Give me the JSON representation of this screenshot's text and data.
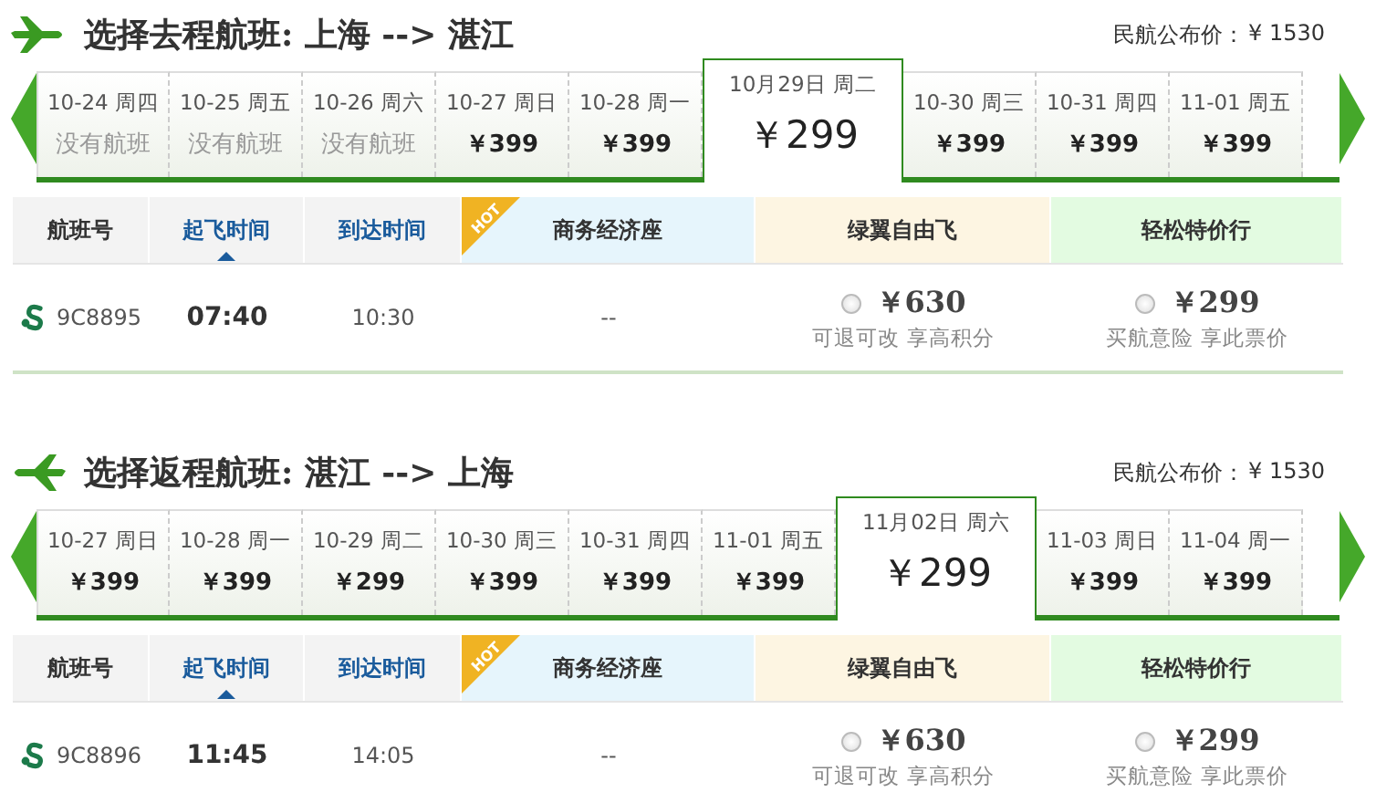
{
  "sections": [
    {
      "kind": "outbound",
      "title": "选择去程航班: 上海 --> 湛江",
      "published_price_label": "民航公布价：",
      "published_price": "¥ 1530",
      "dates": [
        {
          "date": "10-24 周四",
          "price": "没有航班",
          "available": false,
          "selected": false
        },
        {
          "date": "10-25 周五",
          "price": "没有航班",
          "available": false,
          "selected": false
        },
        {
          "date": "10-26 周六",
          "price": "没有航班",
          "available": false,
          "selected": false
        },
        {
          "date": "10-27 周日",
          "price": "￥399",
          "available": true,
          "selected": false
        },
        {
          "date": "10-28 周一",
          "price": "￥399",
          "available": true,
          "selected": false
        },
        {
          "date": "10月29日 周二",
          "price": "￥299",
          "available": true,
          "selected": true
        },
        {
          "date": "10-30 周三",
          "price": "￥399",
          "available": true,
          "selected": false
        },
        {
          "date": "10-31 周四",
          "price": "￥399",
          "available": true,
          "selected": false
        },
        {
          "date": "11-01 周五",
          "price": "￥399",
          "available": true,
          "selected": false
        }
      ],
      "columns": [
        {
          "label": "航班号",
          "kind": "plain",
          "sorted": false
        },
        {
          "label": "起飞时间",
          "kind": "sortable",
          "sorted": true
        },
        {
          "label": "到达时间",
          "kind": "sortable",
          "sorted": false
        },
        {
          "label": "商务经济座",
          "kind": "fare",
          "color": "#e6f5fc",
          "badge": "HOT"
        },
        {
          "label": "绿翼自由飞",
          "kind": "fare",
          "color": "#fdf5e2"
        },
        {
          "label": "轻松特价行",
          "kind": "fare",
          "color": "#e3fbe1"
        }
      ],
      "flights": [
        {
          "flight_no": "9C8895",
          "depart": "07:40",
          "arrive": "10:30",
          "business": "--",
          "fares": [
            {
              "price": "￥630",
              "note": "可退可改 享高积分",
              "selected": false
            },
            {
              "price": "￥299",
              "note": "买航意险 享此票价",
              "selected": false
            }
          ]
        }
      ]
    },
    {
      "kind": "return",
      "title": "选择返程航班: 湛江 --> 上海",
      "published_price_label": "民航公布价：",
      "published_price": "¥ 1530",
      "dates": [
        {
          "date": "10-27 周日",
          "price": "￥399",
          "available": true,
          "selected": false
        },
        {
          "date": "10-28 周一",
          "price": "￥399",
          "available": true,
          "selected": false
        },
        {
          "date": "10-29 周二",
          "price": "￥299",
          "available": true,
          "selected": false
        },
        {
          "date": "10-30 周三",
          "price": "￥399",
          "available": true,
          "selected": false
        },
        {
          "date": "10-31 周四",
          "price": "￥399",
          "available": true,
          "selected": false
        },
        {
          "date": "11-01 周五",
          "price": "￥399",
          "available": true,
          "selected": false
        },
        {
          "date": "11月02日 周六",
          "price": "￥299",
          "available": true,
          "selected": true
        },
        {
          "date": "11-03 周日",
          "price": "￥399",
          "available": true,
          "selected": false
        },
        {
          "date": "11-04 周一",
          "price": "￥399",
          "available": true,
          "selected": false
        }
      ],
      "columns": [
        {
          "label": "航班号",
          "kind": "plain",
          "sorted": false
        },
        {
          "label": "起飞时间",
          "kind": "sortable",
          "sorted": true
        },
        {
          "label": "到达时间",
          "kind": "sortable",
          "sorted": false
        },
        {
          "label": "商务经济座",
          "kind": "fare",
          "color": "#e6f5fc",
          "badge": "HOT"
        },
        {
          "label": "绿翼自由飞",
          "kind": "fare",
          "color": "#fdf5e2"
        },
        {
          "label": "轻松特价行",
          "kind": "fare",
          "color": "#e3fbe1"
        }
      ],
      "flights": [
        {
          "flight_no": "9C8896",
          "depart": "11:45",
          "arrive": "14:05",
          "business": "--",
          "fares": [
            {
              "price": "￥630",
              "note": "可退可改 享高积分",
              "selected": false
            },
            {
              "price": "￥299",
              "note": "买航意险 享此票价",
              "selected": false
            }
          ]
        }
      ]
    }
  ]
}
